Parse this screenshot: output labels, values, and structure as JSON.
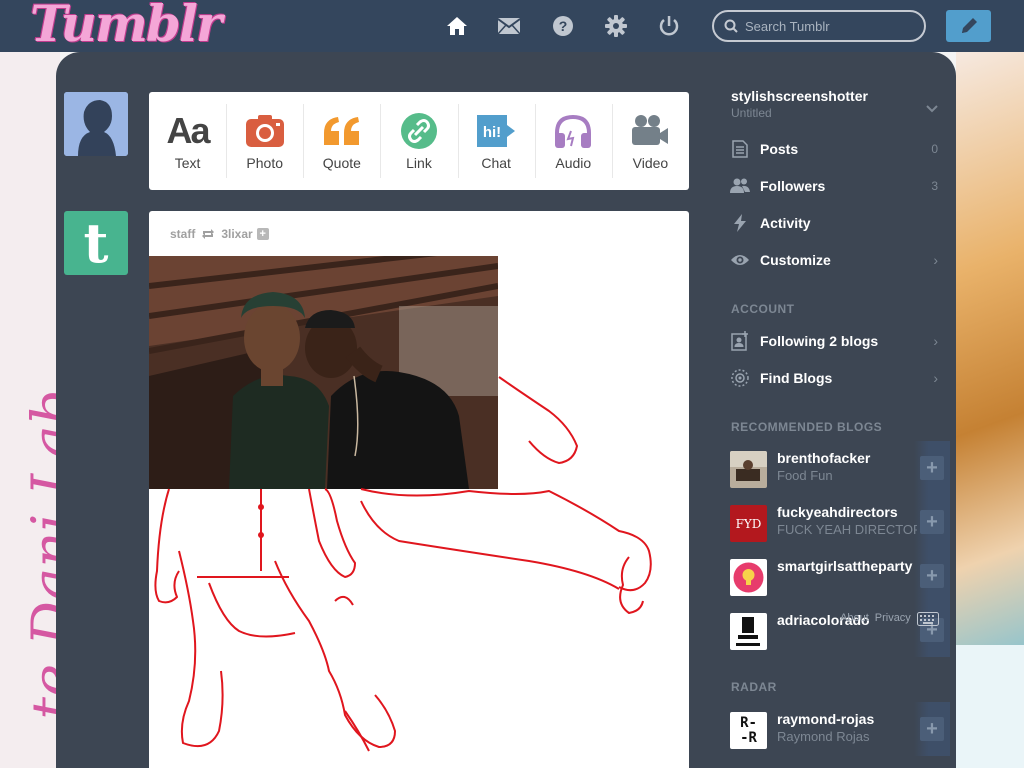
{
  "header": {
    "logo": "Tumblr",
    "nav": [
      "home-icon",
      "mail-icon",
      "help-icon",
      "settings-icon",
      "power-icon"
    ],
    "search_placeholder": "Search Tumblr",
    "compose_icon": "pencil-icon"
  },
  "background": {
    "side_text": "te Dani Lab"
  },
  "post_types": [
    {
      "label": "Text",
      "icon": "text-icon",
      "color": "#444444"
    },
    {
      "label": "Photo",
      "icon": "camera-icon",
      "color": "#d95e40"
    },
    {
      "label": "Quote",
      "icon": "quote-icon",
      "color": "#f2992e"
    },
    {
      "label": "Link",
      "icon": "link-icon",
      "color": "#56bc8a"
    },
    {
      "label": "Chat",
      "icon": "chat-icon",
      "color": "#529ecc"
    },
    {
      "label": "Audio",
      "icon": "headphones-icon",
      "color": "#a77dc2"
    },
    {
      "label": "Video",
      "icon": "video-camera-icon",
      "color": "#748089"
    }
  ],
  "post": {
    "author": "staff",
    "reblogged_from": "3lixar"
  },
  "sidebar": {
    "blog_name": "stylishscreenshotter",
    "blog_subtitle": "Untitled",
    "items": [
      {
        "label": "Posts",
        "icon": "posts-icon",
        "count": "0"
      },
      {
        "label": "Followers",
        "icon": "followers-icon",
        "count": "3"
      },
      {
        "label": "Activity",
        "icon": "lightning-icon",
        "count": ""
      },
      {
        "label": "Customize",
        "icon": "eye-icon",
        "count": "›"
      }
    ],
    "account_heading": "ACCOUNT",
    "account_items": [
      {
        "label": "Following 2 blogs",
        "icon": "following-icon"
      },
      {
        "label": "Find Blogs",
        "icon": "compass-icon"
      }
    ],
    "recommended_heading": "RECOMMENDED BLOGS",
    "recommended": [
      {
        "name": "brenthofacker",
        "sub": "Food Fun"
      },
      {
        "name": "fuckyeahdirectors",
        "sub": "FUCK YEAH DIRECTORS",
        "badge": "FYD"
      },
      {
        "name": "smartgirlsattheparty",
        "sub": ""
      },
      {
        "name": "adriacolorado",
        "sub": ""
      }
    ],
    "footer_links": [
      "About",
      "Privacy"
    ],
    "radar_heading": "RADAR",
    "radar": {
      "name": "raymond-rojas",
      "sub": "Raymond Rojas",
      "badge_top": "R-",
      "badge_bottom": "-R"
    }
  },
  "colors": {
    "header_bg": "#34465d",
    "dashboard_bg": "#3d4653",
    "accent_blue": "#529ecc",
    "drawing_red": "#e0161e"
  }
}
